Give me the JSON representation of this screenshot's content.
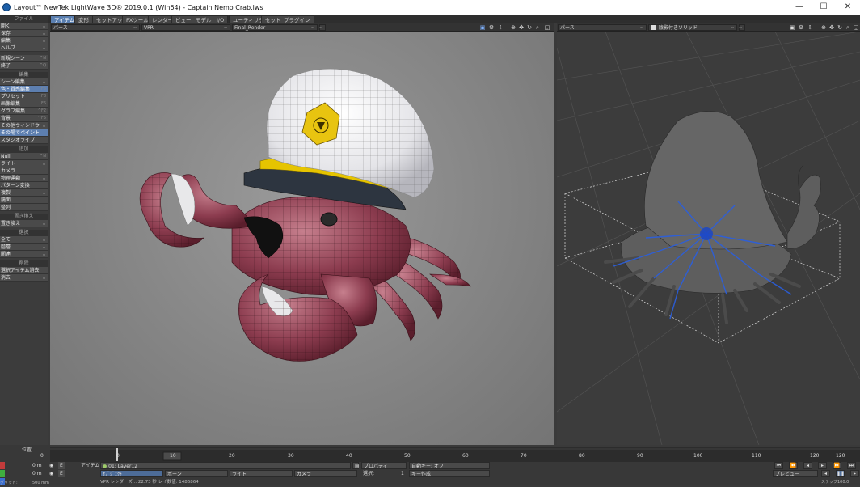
{
  "window": {
    "title": "Layout™ NewTek LightWave 3D® 2019.0.1 (Win64) - Captain Nemo Crab.lws",
    "controls": [
      "—",
      "☐",
      "✕"
    ]
  },
  "tabs": [
    "アイテム",
    "変形",
    "セットアップ",
    "FXツール",
    "レンダー",
    "ビュー",
    "モデル",
    "I/O",
    "ユーティリティ",
    "セット",
    "プラグイン"
  ],
  "left_panel": {
    "file_header": "ファイル",
    "file_items": [
      {
        "label": "開く",
        "arrow": "⌄"
      },
      {
        "label": "保存",
        "arrow": "⌄"
      },
      {
        "label": "編集",
        "arrow": "⌄"
      },
      {
        "label": "ヘルプ",
        "arrow": "⌄"
      }
    ],
    "file_items2": [
      {
        "label": "新規シーン",
        "shortcut": "^N"
      },
      {
        "label": "終了",
        "shortcut": "^Q"
      }
    ],
    "edit_header": "編集",
    "edit_items": [
      {
        "label": "シーン編集",
        "shortcut": "⌄"
      },
      {
        "label": "色・質感編集",
        "shortcut": "F5",
        "highlight": true
      },
      {
        "label": "プリセット",
        "shortcut": "F8"
      },
      {
        "label": "画像編集",
        "shortcut": "F6"
      },
      {
        "label": "グラフ編集",
        "shortcut": "^F2"
      },
      {
        "label": "背景",
        "shortcut": "^F5"
      },
      {
        "label": "その他ウィンドウ",
        "shortcut": "⌄"
      },
      {
        "label": "その場でペイント",
        "shortcut": "",
        "highlight": true
      },
      {
        "label": "スタジオライブ",
        "shortcut": ""
      }
    ],
    "add_header": "追加",
    "add_items": [
      {
        "label": "Null",
        "shortcut": "^N"
      },
      {
        "label": "ライト",
        "shortcut": "⌄"
      },
      {
        "label": "カメラ",
        "shortcut": ""
      },
      {
        "label": "物理運動",
        "shortcut": "⌄"
      },
      {
        "label": "パターン変換",
        "shortcut": ""
      },
      {
        "label": "複製",
        "shortcut": "⌄"
      },
      {
        "label": "鏡面",
        "shortcut": ""
      },
      {
        "label": "整列",
        "shortcut": ""
      }
    ],
    "replace_header": "置き換え",
    "replace_items": [
      {
        "label": "置き換え",
        "shortcut": "⌄"
      }
    ],
    "select_header": "選択",
    "select_items": [
      {
        "label": "全て",
        "shortcut": "⌄"
      },
      {
        "label": "階層",
        "shortcut": "⌄"
      },
      {
        "label": "関連",
        "shortcut": "⌄"
      }
    ],
    "delete_header": "削除",
    "delete_items": [
      {
        "label": "選択アイテム消去",
        "shortcut": ""
      },
      {
        "label": "消去",
        "shortcut": "⌄"
      }
    ]
  },
  "viewport1": {
    "view": "パース",
    "mode": "VPR",
    "render": "Final_Render"
  },
  "viewport2": {
    "view": "パース",
    "mode": "陰影付きソリッド"
  },
  "timeline": {
    "ticks": [
      "0",
      "10",
      "20",
      "30",
      "40",
      "50",
      "60",
      "70",
      "80",
      "90",
      "100",
      "110",
      "120"
    ],
    "current": "0",
    "end_label": "120"
  },
  "bottom": {
    "position_label": "位置",
    "x_value": "0 m",
    "y_value": "0 m",
    "z_value": "0 m",
    "item_label": "アイテム",
    "item_value": "01: Layer12",
    "property_label": "プロパティ",
    "autokey_label": "自動キー: オフ",
    "object_btn": "ｵﾌﾞｼﾞｪｸﾄ",
    "bone_btn": "ボーン",
    "light_btn": "ライト",
    "camera_btn": "カメラ",
    "selection_label": "選択:",
    "selection_value": "1",
    "key_create": "キー作成",
    "status": "VPR レンダーズ... 22.73 秒 レイ数値: 1486864",
    "grid_label": "グリッド:",
    "grid_value": "500 mm",
    "preview_label": "プレビュー",
    "step_label": "ステップ",
    "fps_value": "100.0"
  }
}
